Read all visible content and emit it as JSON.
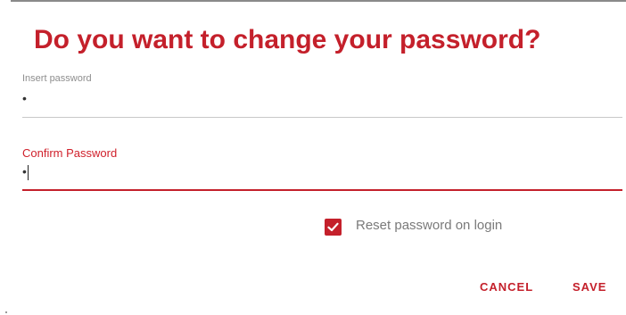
{
  "dialog": {
    "title": "Do you want to change your password?",
    "password_field": {
      "label": "Insert password",
      "value": "•"
    },
    "confirm_field": {
      "label": "Confirm Password",
      "value": "•"
    },
    "reset_checkbox": {
      "label": "Reset password on login",
      "checked": true
    },
    "actions": {
      "cancel_label": "CANCEL",
      "save_label": "SAVE"
    }
  },
  "colors": {
    "accent": "#c4202b",
    "muted_text": "#8e8e8e",
    "divider": "#c9c9c9"
  }
}
